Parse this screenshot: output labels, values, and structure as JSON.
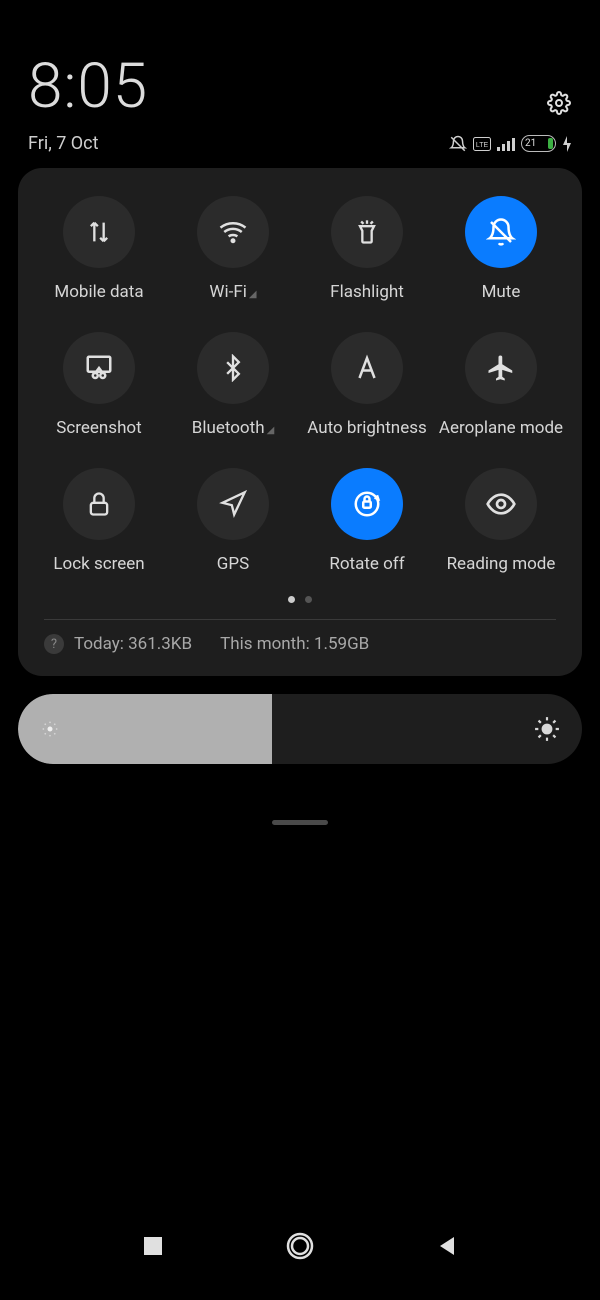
{
  "header": {
    "time": "8:05",
    "date": "Fri, 7 Oct",
    "battery": "21"
  },
  "tiles": [
    {
      "label": "Mobile data"
    },
    {
      "label": "Wi-Fi"
    },
    {
      "label": "Flashlight"
    },
    {
      "label": "Mute"
    },
    {
      "label": "Screenshot"
    },
    {
      "label": "Bluetooth"
    },
    {
      "label": "Auto brightness"
    },
    {
      "label": "Aeroplane mode"
    },
    {
      "label": "Lock screen"
    },
    {
      "label": "GPS"
    },
    {
      "label": "Rotate off"
    },
    {
      "label": "Reading mode"
    }
  ],
  "usage": {
    "today": "Today: 361.3KB",
    "month": "This month: 1.59GB"
  },
  "brightness_percent": 45
}
